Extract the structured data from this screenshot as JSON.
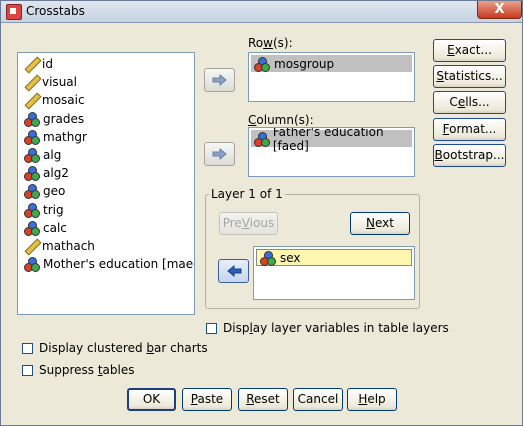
{
  "window": {
    "title": "Crosstabs",
    "close_glyph": "X"
  },
  "source_list": {
    "items": [
      {
        "label": "id",
        "icon": "ruler-icon"
      },
      {
        "label": "visual",
        "icon": "ruler-icon"
      },
      {
        "label": "mosaic",
        "icon": "ruler-icon"
      },
      {
        "label": "grades",
        "icon": "nominal-icon"
      },
      {
        "label": "mathgr",
        "icon": "nominal-icon"
      },
      {
        "label": "alg",
        "icon": "nominal-icon"
      },
      {
        "label": "alg2",
        "icon": "nominal-icon"
      },
      {
        "label": "geo",
        "icon": "nominal-icon"
      },
      {
        "label": "trig",
        "icon": "nominal-icon"
      },
      {
        "label": "calc",
        "icon": "nominal-icon"
      },
      {
        "label": "mathach",
        "icon": "ruler-icon"
      },
      {
        "label": "Mother's education [maed]",
        "icon": "nominal-icon"
      }
    ]
  },
  "rows": {
    "label_pre": "Ro",
    "label_key": "w",
    "label_post": "(s):",
    "items": [
      "mosgroup"
    ]
  },
  "columns": {
    "label_key": "C",
    "label_post": "olumn(s):",
    "items": [
      "Father's education [faed]"
    ]
  },
  "layer": {
    "title": "Layer 1 of 1",
    "previous_key": "V",
    "previous_pre": "Pre",
    "previous_post": "ious",
    "next_key": "N",
    "next_post": "ext",
    "items": [
      "sex"
    ]
  },
  "side_buttons": [
    {
      "pre": "",
      "key": "E",
      "post": "xact..."
    },
    {
      "pre": "",
      "key": "S",
      "post": "tatistics..."
    },
    {
      "pre": "C",
      "key": "e",
      "post": "lls..."
    },
    {
      "pre": "",
      "key": "F",
      "post": "ormat..."
    },
    {
      "pre": "",
      "key": "B",
      "post": "ootstrap..."
    }
  ],
  "checkboxes": {
    "display_layer": {
      "pre": "Disp",
      "key": "l",
      "post": "ay layer variables in table layers",
      "checked": false
    },
    "clustered_bar": {
      "pre": "Display clustered ",
      "key": "b",
      "post": "ar charts",
      "checked": false
    },
    "suppress": {
      "pre": "Suppress ",
      "key": "t",
      "post": "ables",
      "checked": false
    }
  },
  "footer": {
    "ok": "OK",
    "paste_key": "P",
    "paste_post": "aste",
    "reset_key": "R",
    "reset_post": "eset",
    "cancel": "Cancel",
    "help_key": "H",
    "help_post": "elp"
  },
  "colors": {
    "selected_gray": "#c0c0c0",
    "highlight_yellow": "#fff6b0",
    "dialog_bg": "#ece9d8"
  }
}
